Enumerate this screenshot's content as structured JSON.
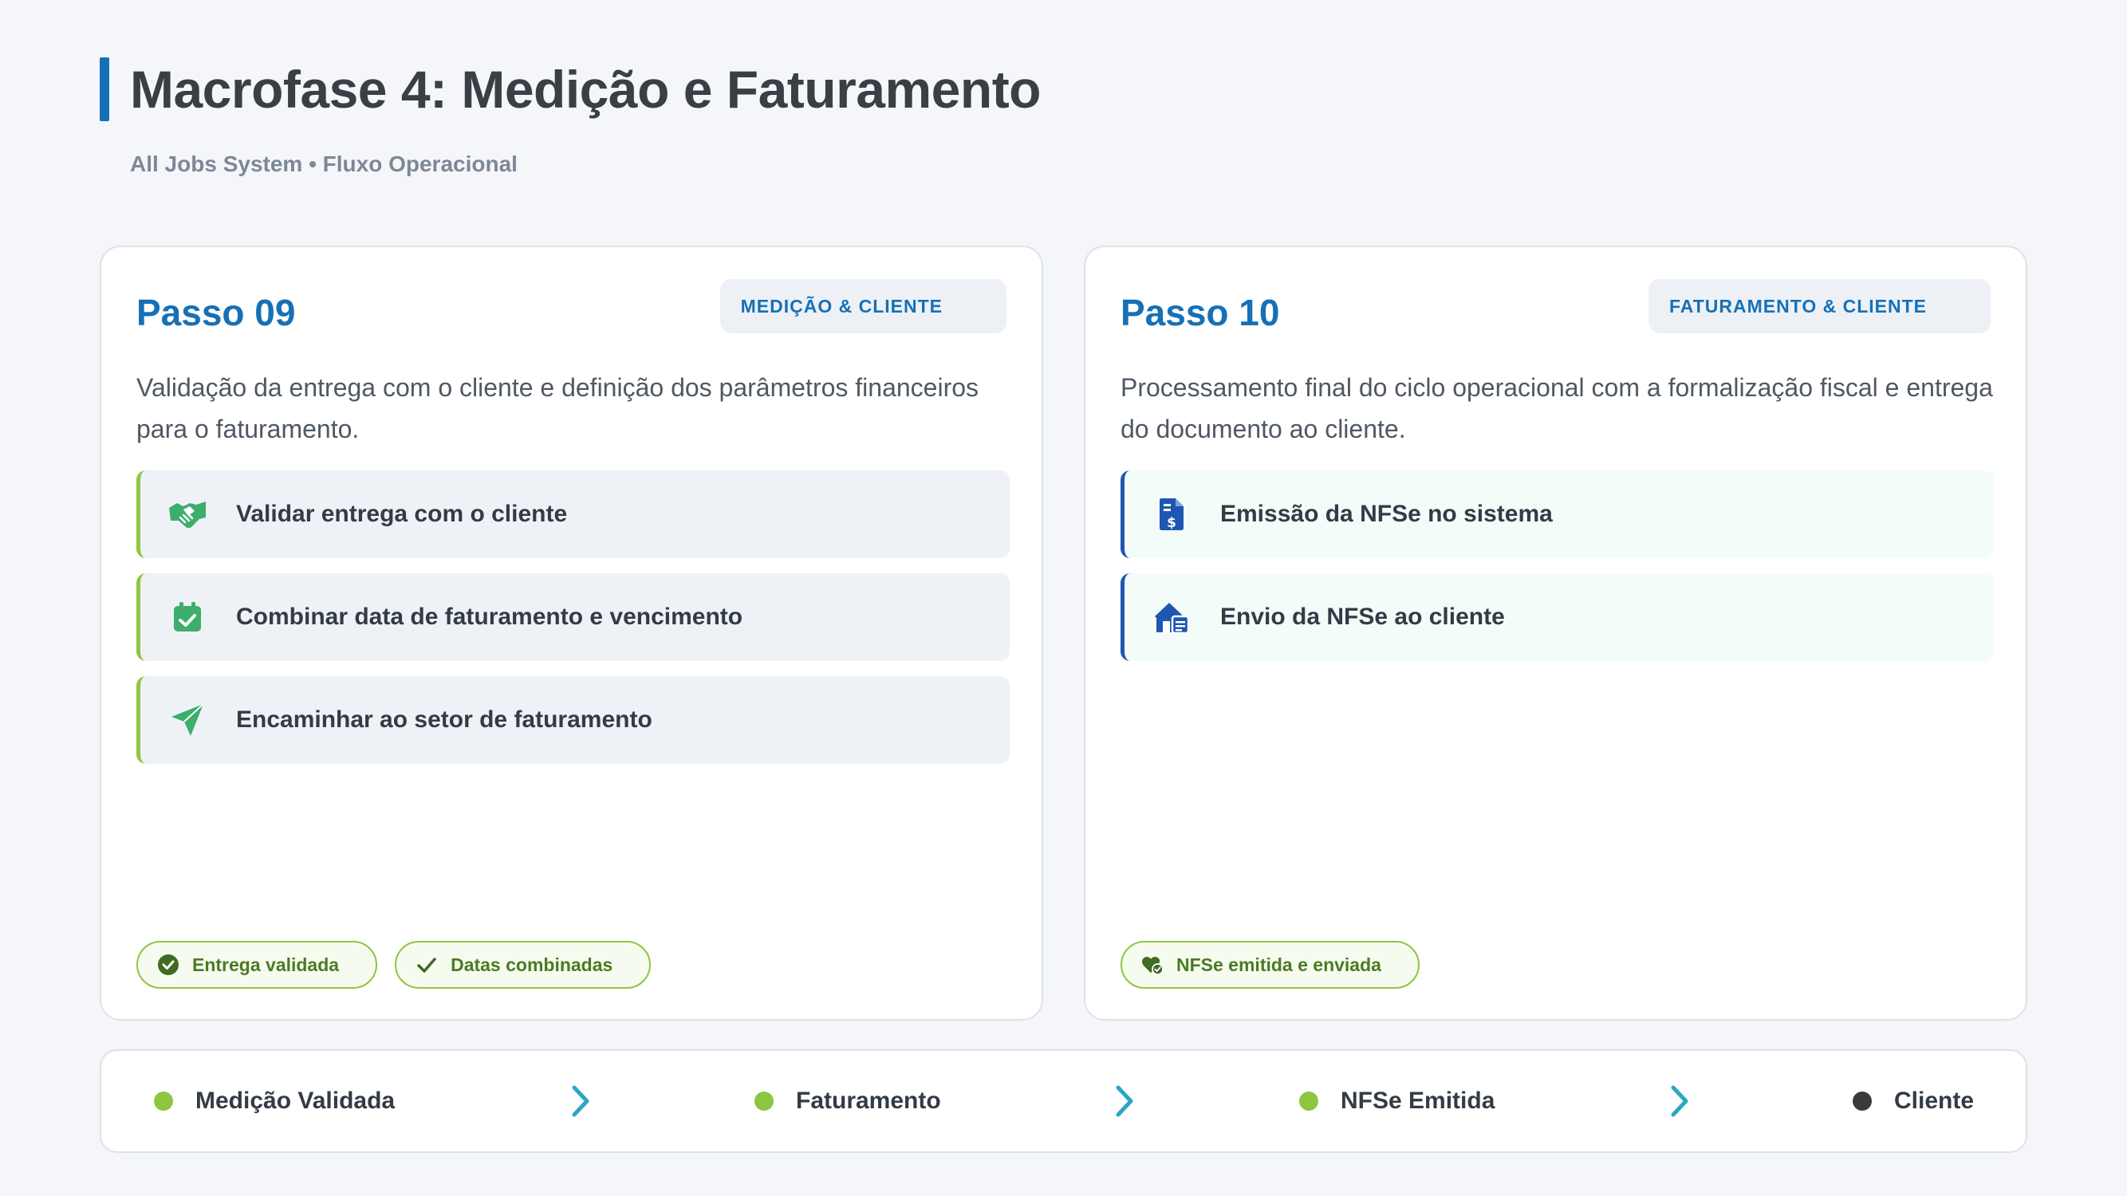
{
  "header": {
    "title": "Macrofase 4: Medição e Faturamento",
    "subtitle": "All Jobs System • Fluxo Operacional",
    "accent_color": "#1670b6"
  },
  "cards": [
    {
      "step": "Passo 09",
      "tag": "MEDIÇÃO & CLIENTE",
      "description": "Validação da entrega com o cliente e definição dos parâmetros financeiros para o faturamento.",
      "items": [
        {
          "icon": "handshake-icon",
          "label": "Validar entrega com o cliente"
        },
        {
          "icon": "calendar-check-icon",
          "label": "Combinar data de faturamento e vencimento"
        },
        {
          "icon": "paper-plane-icon",
          "label": "Encaminhar ao setor de faturamento"
        }
      ],
      "badges": [
        {
          "icon": "check-circle-icon",
          "label": "Entrega validada"
        },
        {
          "icon": "check-icon",
          "label": "Datas combinadas"
        }
      ]
    },
    {
      "step": "Passo 10",
      "tag": "FATURAMENTO & CLIENTE",
      "description": "Processamento final do ciclo operacional com a formalização fiscal e entrega do documento ao cliente.",
      "items": [
        {
          "icon": "invoice-dollar-icon",
          "label": "Emissão da NFSe no sistema"
        },
        {
          "icon": "house-document-icon",
          "label": "Envio da NFSe ao cliente"
        }
      ],
      "badges": [
        {
          "icon": "heart-check-icon",
          "label": "NFSe emitida e enviada"
        }
      ]
    }
  ],
  "flow": [
    {
      "label": "Medição Validada",
      "color": "#8dc63f"
    },
    {
      "label": "Faturamento",
      "color": "#8dc63f"
    },
    {
      "label": "NFSe Emitida",
      "color": "#8dc63f"
    },
    {
      "label": "Cliente",
      "color": "#3a3a3a"
    }
  ],
  "colors": {
    "green": "#8dc63f",
    "icon_green": "#3dae6b",
    "blue": "#1670b6",
    "dark_blue": "#1f56b3",
    "chevron": "#2aa7c4"
  }
}
